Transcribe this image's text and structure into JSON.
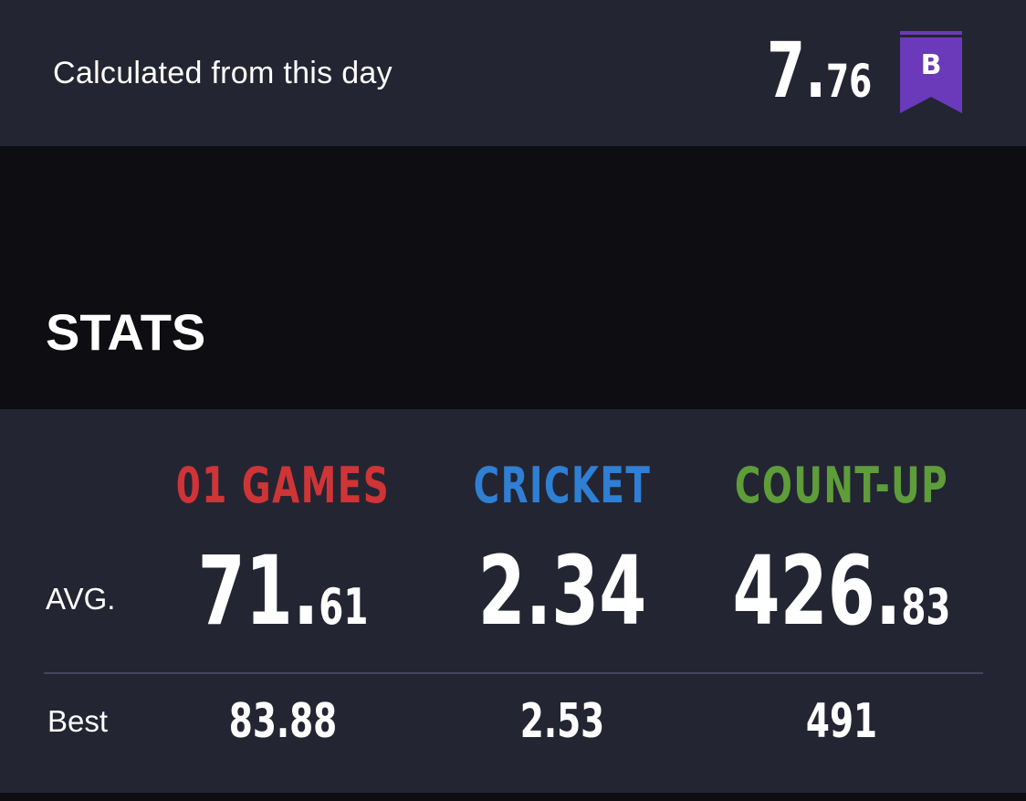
{
  "header": {
    "calc_label": "Calculated from this day",
    "rating_int": "7.",
    "rating_dec": "76",
    "rank_letter": "B",
    "rank_color": "#6a3aba"
  },
  "stats": {
    "title": "STATS",
    "avg_label": "AVG.",
    "best_label": "Best",
    "columns": [
      {
        "name": "01 GAMES",
        "color": "#cf3437",
        "avg_int": "71.",
        "avg_dec": "61",
        "best": "83.88"
      },
      {
        "name": "CRICKET",
        "color": "#2f7fd4",
        "avg_int": "2.34",
        "avg_dec": "",
        "best": "2.53"
      },
      {
        "name": "COUNT-UP",
        "color": "#5e9d3a",
        "avg_int": "426.",
        "avg_dec": "83",
        "best": "491"
      }
    ]
  }
}
